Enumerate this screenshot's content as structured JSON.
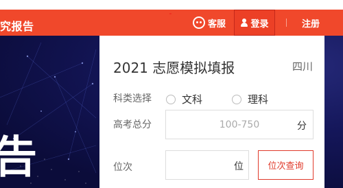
{
  "header": {
    "brand_partial": "究报告",
    "service_label": "客服",
    "login_label": "登录",
    "register_label": "注册"
  },
  "hero": {
    "big_char": "告"
  },
  "form": {
    "title": "2021 志愿模拟填报",
    "region": "四川",
    "subject_label": "科类选择",
    "subject_options": [
      "文科",
      "理科"
    ],
    "score_label": "高考总分",
    "score_placeholder": "100-750",
    "score_unit": "分",
    "rank_label": "位次",
    "rank_unit": "位",
    "rank_query_button": "位次查询"
  },
  "colors": {
    "brand_red": "#f0482b",
    "hero_navy": "#0e0f3e",
    "accent_red": "#e0392a"
  }
}
